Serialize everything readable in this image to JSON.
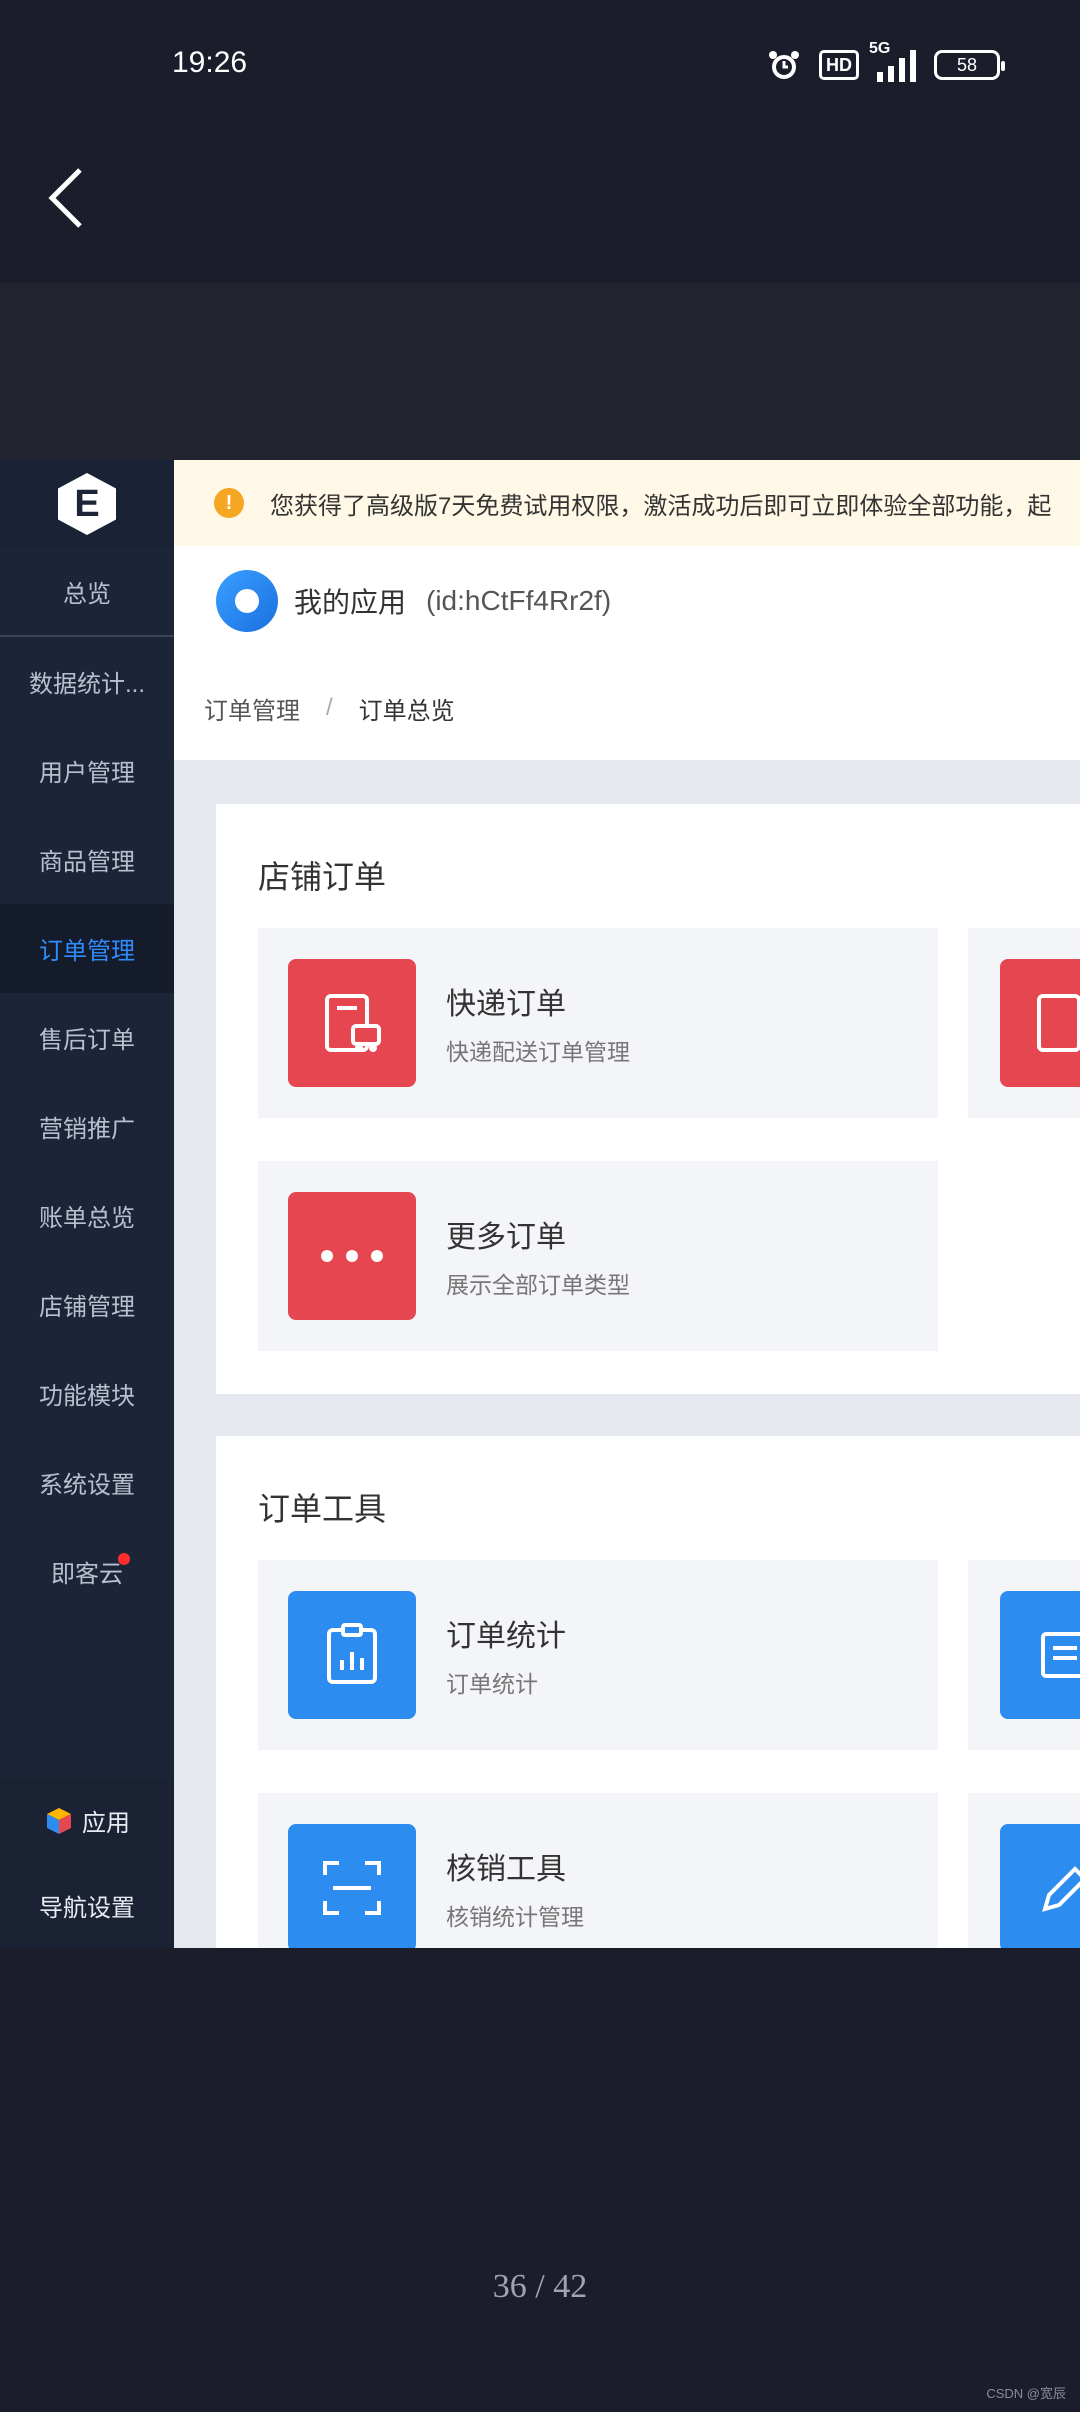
{
  "status_bar": {
    "time": "19:26",
    "hd": "HD",
    "network": "5G",
    "battery": "58"
  },
  "sidebar": {
    "items": [
      {
        "label": "总览"
      },
      {
        "label": "数据统计..."
      },
      {
        "label": "用户管理"
      },
      {
        "label": "商品管理"
      },
      {
        "label": "订单管理"
      },
      {
        "label": "售后订单"
      },
      {
        "label": "营销推广"
      },
      {
        "label": "账单总览"
      },
      {
        "label": "店铺管理"
      },
      {
        "label": "功能模块"
      },
      {
        "label": "系统设置"
      },
      {
        "label": "即客云"
      }
    ],
    "bottom": {
      "apps_label": "应用",
      "nav_settings_label": "导航设置"
    }
  },
  "notice": {
    "text": "您获得了高级版7天免费试用权限，激活成功后即可立即体验全部功能，起"
  },
  "app": {
    "name": "我的应用",
    "id": "(id:hCtFf4Rr2f)"
  },
  "breadcrumb": {
    "parent": "订单管理",
    "separator": "/",
    "current": "订单总览"
  },
  "store_orders": {
    "title": "店铺订单",
    "cards": [
      {
        "title": "快递订单",
        "desc": "快递配送订单管理"
      },
      {
        "title": "更多订单",
        "desc": "展示全部订单类型"
      }
    ]
  },
  "order_tools": {
    "title": "订单工具",
    "cards": [
      {
        "title": "订单统计",
        "desc": "订单统计"
      },
      {
        "title": "核销工具",
        "desc": "核销统计管理"
      }
    ]
  },
  "pager": {
    "text": "36 / 42"
  },
  "watermark": {
    "text": "CSDN @宽辰"
  }
}
